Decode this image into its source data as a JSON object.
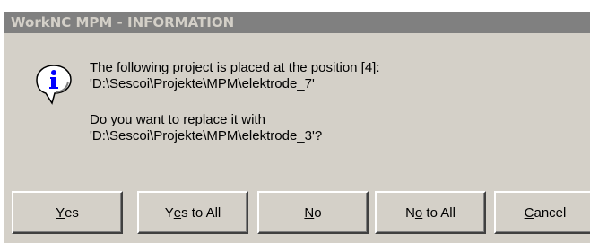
{
  "window": {
    "title": "WorkNC MPM - INFORMATION"
  },
  "icon": "information-icon",
  "message": {
    "line1": "The following project is placed at the position [4]:",
    "line2": "'D:\\Sescoi\\Projekte\\MPM\\elektrode_7'",
    "line3": "Do you want to replace it with",
    "line4": "'D:\\Sescoi\\Projekte\\MPM\\elektrode_3'?"
  },
  "buttons": {
    "yes": {
      "pre": "",
      "mnemonic": "Y",
      "post": "es"
    },
    "yes_to_all": {
      "pre": "Y",
      "mnemonic": "e",
      "post": "s to All"
    },
    "no": {
      "pre": "",
      "mnemonic": "N",
      "post": "o"
    },
    "no_to_all": {
      "pre": "N",
      "mnemonic": "o",
      "post": " to All"
    },
    "cancel": {
      "pre": "",
      "mnemonic": "C",
      "post": "ancel"
    }
  },
  "colors": {
    "dialog_face": "#d4d0c8",
    "titlebar_inactive": "#808080",
    "title_text": "#d4d0c8",
    "icon_blue": "#0000ff"
  }
}
